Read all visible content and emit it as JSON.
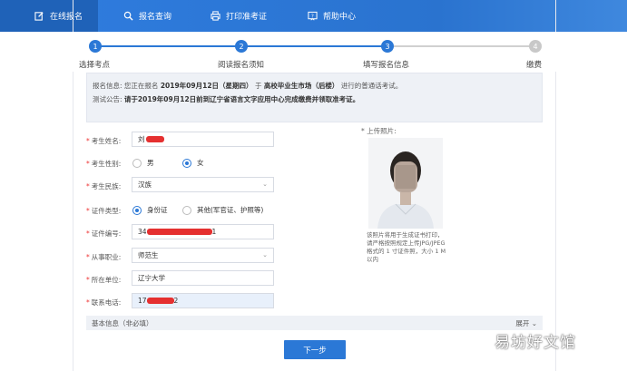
{
  "nav": {
    "items": [
      {
        "label": "在线报名",
        "icon": "edit-icon",
        "active": true
      },
      {
        "label": "报名查询",
        "icon": "search-icon",
        "active": false
      },
      {
        "label": "打印准考证",
        "icon": "printer-icon",
        "active": false
      },
      {
        "label": "帮助中心",
        "icon": "help-icon",
        "active": false
      }
    ]
  },
  "steps": [
    {
      "num": "1",
      "label": "选择考点",
      "state": "done"
    },
    {
      "num": "2",
      "label": "阅读报名须知",
      "state": "done"
    },
    {
      "num": "3",
      "label": "填写报名信息",
      "state": "current"
    },
    {
      "num": "4",
      "label": "缴费",
      "state": "todo"
    }
  ],
  "notice": {
    "line1_prefix": "报名信息: 您正在报名",
    "line1_date": "2019年09月12日（星期四）",
    "line1_mid": "于",
    "line1_venue": "高校毕业生市场（后楼）",
    "line1_suffix": "进行的普通话考试。",
    "line2_prefix": "测试公告:",
    "line2_text": "请于2019年09月12日前到辽宁省语言文字应用中心完成缴费并领取准考证。"
  },
  "form": {
    "name": {
      "label": "考生姓名:",
      "value": "刘"
    },
    "gender": {
      "label": "考生性别:",
      "options": [
        "男",
        "女"
      ],
      "selected": "女"
    },
    "ethnicity": {
      "label": "考生民族:",
      "value": "汉族"
    },
    "id_type": {
      "label": "证件类型:",
      "options": [
        "身份证",
        "其他(军官证、护照等)"
      ],
      "selected": "身份证"
    },
    "id_number": {
      "label": "证件编号:",
      "prefix": "34",
      "suffix": "1"
    },
    "occupation": {
      "label": "从事职业:",
      "value": "师范生"
    },
    "employer": {
      "label": "所在单位:",
      "value": "辽宁大学"
    },
    "phone": {
      "label": "联系电话:",
      "prefix": "17",
      "suffix": "2"
    }
  },
  "photo": {
    "label": "* 上传照片:",
    "note": "该照片将用于生成证书打印，请严格按照规定上传JPG/JPEG格式的 1 寸证件照，大小 1 M 以内"
  },
  "basic_info": {
    "label": "基本信息（非必填）",
    "expand": "展开 ⌄"
  },
  "next_button": "下一步",
  "watermark": "易坊好文馆",
  "colors": {
    "primary": "#2b78d6",
    "todo": "#c8c8c8",
    "required": "#e33333",
    "redaction": "#e53030"
  }
}
